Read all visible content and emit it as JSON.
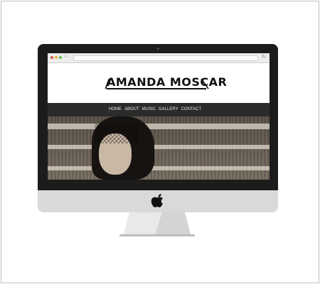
{
  "website": {
    "logo_text": "AMANDA MOSCAR",
    "nav_items": [
      "HOME",
      "ABOUT",
      "MUSIC",
      "GALLERY",
      "CONTACT"
    ]
  },
  "icons": {
    "device_logo": "apple-logo-icon",
    "browser_window_controls": [
      "close",
      "minimize",
      "zoom"
    ]
  },
  "colors": {
    "device_bezel": "#1c1c1c",
    "device_chin": "#d9d9d9",
    "nav_background": "#2b2b2b",
    "nav_text": "#e6e6e6"
  }
}
